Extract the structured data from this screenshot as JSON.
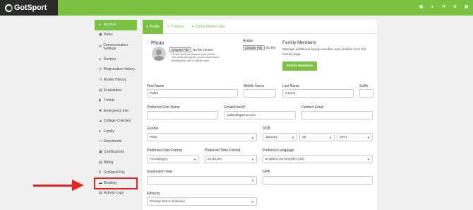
{
  "brand": {
    "name": "GotSport"
  },
  "top_icons": [
    "grid-icon",
    "user-icon",
    "mail-icon",
    "gear-icon",
    "apps-icon"
  ],
  "sidebar": {
    "items": [
      {
        "label": "Account",
        "icon": "user-icon",
        "active": true
      },
      {
        "label": "Roles",
        "icon": "id-card-icon"
      },
      {
        "label": "Communication Settings",
        "icon": "envelope-icon"
      },
      {
        "label": "Rosters",
        "icon": "users-icon"
      },
      {
        "label": "Registration History",
        "icon": "history-icon"
      },
      {
        "label": "Roster History",
        "icon": "history-icon"
      },
      {
        "label": "Evaluations",
        "icon": "clipboard-icon"
      },
      {
        "label": "Tickets",
        "icon": "ticket-icon"
      },
      {
        "label": "Emergency Info",
        "icon": "medkit-icon"
      },
      {
        "label": "College Coaches",
        "icon": "coach-icon"
      },
      {
        "label": "Family",
        "icon": "family-icon"
      },
      {
        "label": "Documents",
        "icon": "folder-icon"
      },
      {
        "label": "Certifications",
        "icon": "certificate-icon"
      },
      {
        "label": "Billing",
        "icon": "billing-icon"
      },
      {
        "label": "GotSport Pay",
        "icon": "dollar-icon"
      },
      {
        "label": "Booking",
        "icon": "bed-icon",
        "highlighted": true
      },
      {
        "label": "Activity Logs",
        "icon": "log-icon"
      }
    ]
  },
  "tabs": [
    {
      "label": "Profile",
      "active": true
    },
    {
      "label": "Themes"
    },
    {
      "label": "Social Media Links"
    }
  ],
  "photo": {
    "label": "Photo",
    "file_button": "Choose File",
    "file_status": "No file chosen",
    "note": "Please upload a passport style portrait. This photo will appear on your association identification card or official roster."
  },
  "avatar": {
    "label": "Avatar",
    "file_button": "Choose File",
    "file_status": "No file"
  },
  "family": {
    "title": "Family Members",
    "description": "Manage additional family member user profiles from the Family page.",
    "button": "Family Members"
  },
  "form": {
    "first_name": {
      "label": "First Name",
      "value": "Pablo"
    },
    "middle_name": {
      "label": "Middle Name",
      "value": ""
    },
    "last_name": {
      "label": "Last Name",
      "value": "Garcia"
    },
    "suffix": {
      "label": "Suffix",
      "value": ""
    },
    "preferred_first_name": {
      "label": "Preferred First Name",
      "value": ""
    },
    "email": {
      "label": "Email/UserID",
      "value": "pablo@garcia.com"
    },
    "contact_email": {
      "label": "Contact Email",
      "value": ""
    },
    "gender": {
      "label": "Gender",
      "value": "Male"
    },
    "dob": {
      "label": "DOB",
      "month": "January",
      "day": "29",
      "year": "2001"
    },
    "date_format": {
      "label": "Preferred Date Format",
      "value": "mm/dd/yyyy"
    },
    "time_format": {
      "label": "Preferred Time Format",
      "value": "01:00 pm"
    },
    "language": {
      "label": "Preferred Language",
      "value": "English (US) English (US)"
    },
    "graduation_year": {
      "label": "Graduation Year",
      "value": ""
    },
    "gpa": {
      "label": "GPA",
      "value": ""
    },
    "ethnicity": {
      "label": "Ethnicity",
      "value": "Choose Not to Disclose"
    }
  },
  "colors": {
    "accent": "#7bc142",
    "header_dark": "#2b2b2b",
    "highlight": "#e8251f"
  }
}
